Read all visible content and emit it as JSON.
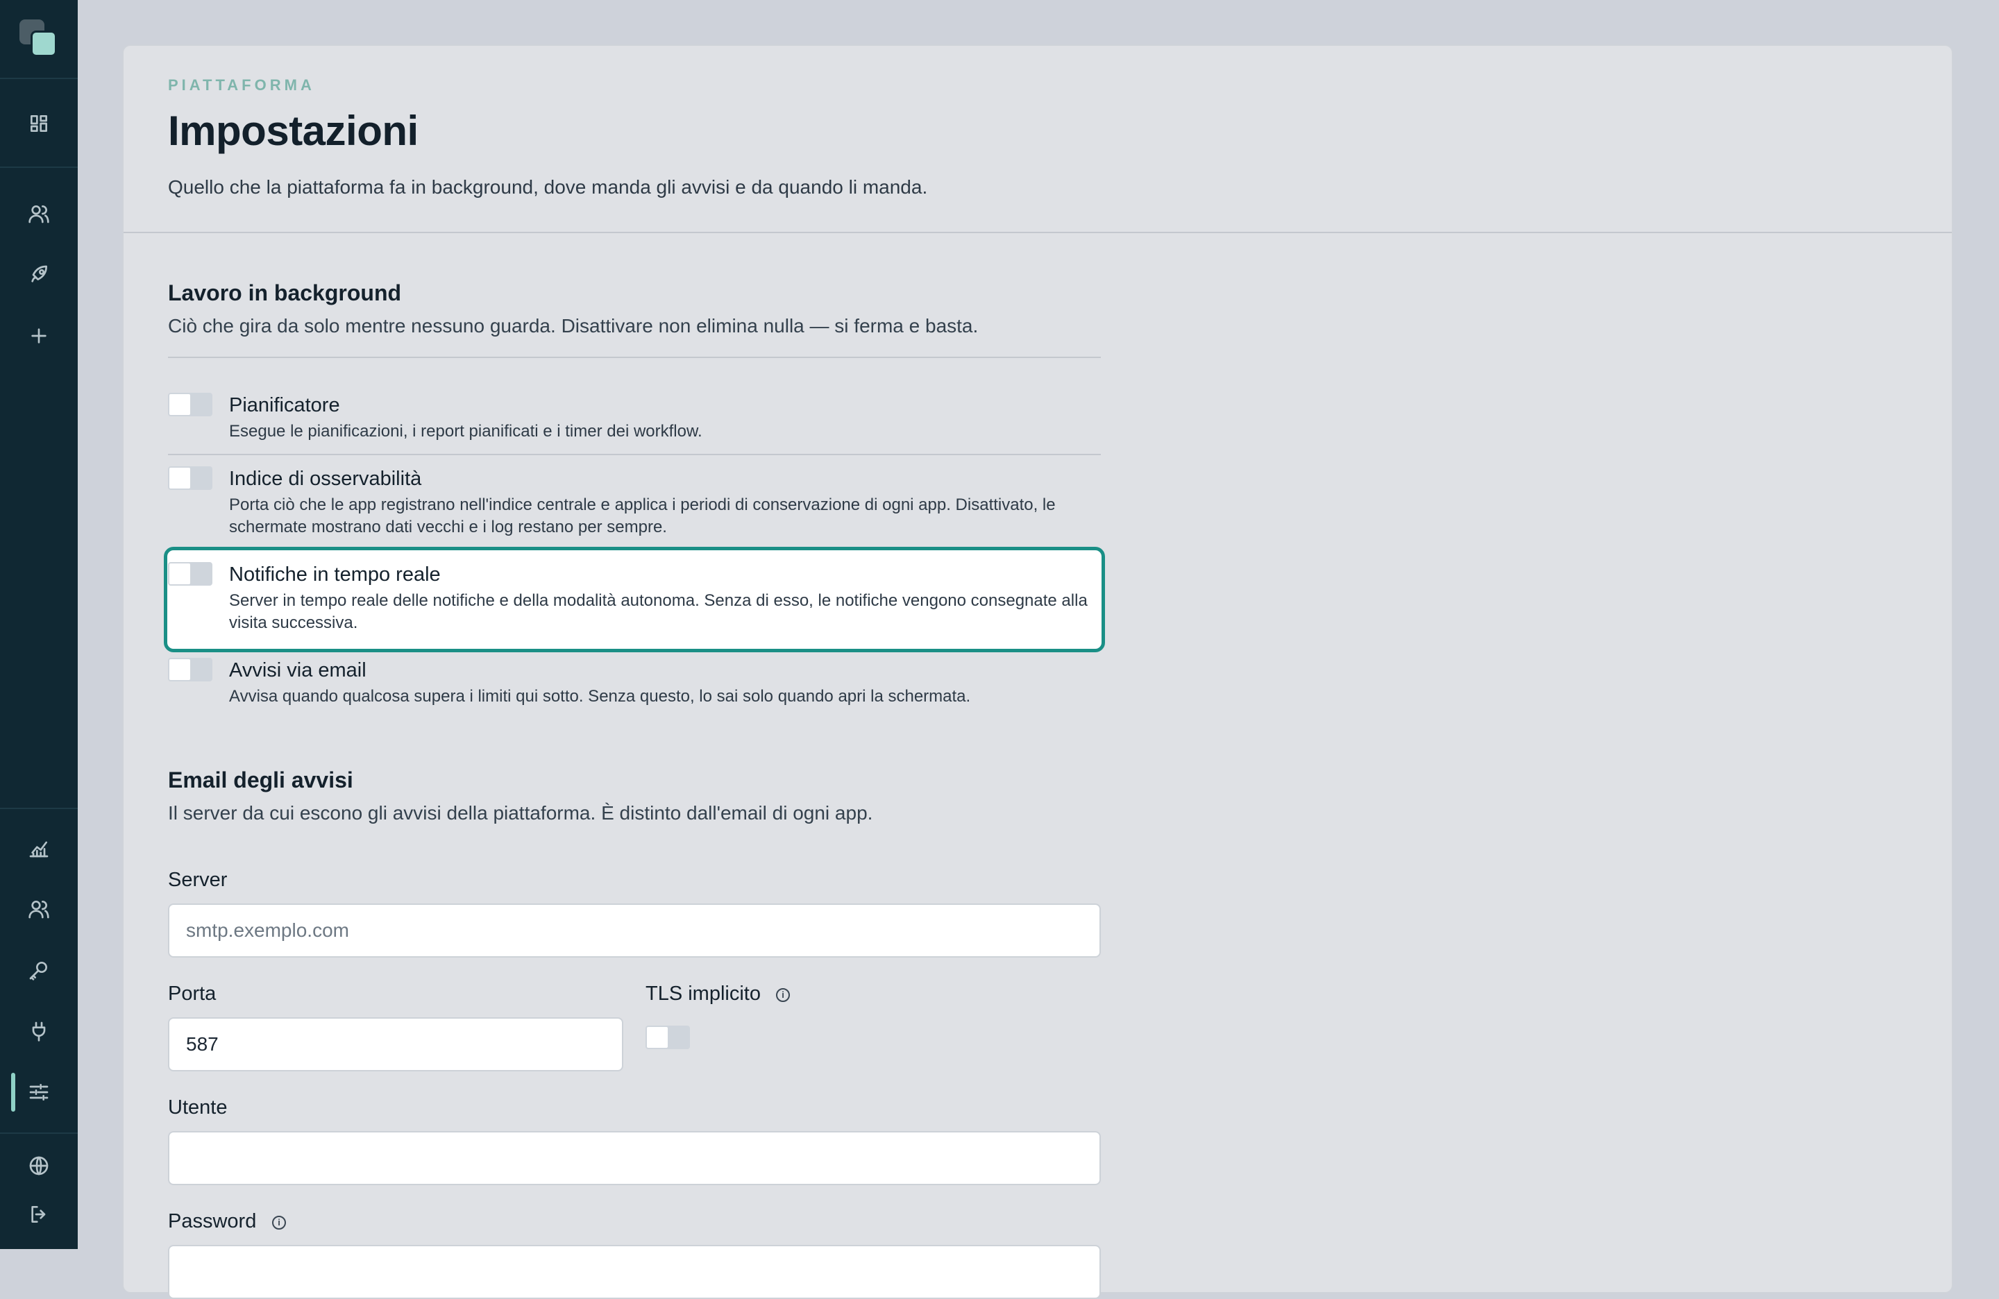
{
  "header": {
    "eyebrow": "PIATTAFORMA",
    "title": "Impostazioni",
    "subtitle": "Quello che la piattaforma fa in background, dove manda gli avvisi e da quando li manda."
  },
  "background_section": {
    "title": "Lavoro in background",
    "subtitle": "Ciò che gira da solo mentre nessuno guarda. Disattivare non elimina nulla — si ferma e basta.",
    "items": [
      {
        "title": "Pianificatore",
        "desc": "Esegue le pianificazioni, i report pianificati e i timer dei workflow.",
        "enabled": false
      },
      {
        "title": "Indice di osservabilità",
        "desc": "Porta ciò che le app registrano nell'indice centrale e applica i periodi di conservazione di ogni app. Disattivato, le schermate mostrano dati vecchi e i log restano per sempre.",
        "enabled": false
      },
      {
        "title": "Notifiche in tempo reale",
        "desc": "Server in tempo reale delle notifiche e della modalità autonoma. Senza di esso, le notifiche vengono consegnate alla visita successiva.",
        "enabled": false,
        "focused": true
      },
      {
        "title": "Avvisi via email",
        "desc": "Avvisa quando qualcosa supera i limiti qui sotto. Senza questo, lo sai solo quando apri la schermata.",
        "enabled": false
      }
    ]
  },
  "email_section": {
    "title": "Email degli avvisi",
    "subtitle": "Il server da cui escono gli avvisi della piattaforma. È distinto dall'email di ogni app.",
    "server_label": "Server",
    "server_placeholder": "smtp.exemplo.com",
    "server_value": "",
    "port_label": "Porta",
    "port_value": "587",
    "tls_label": "TLS implicito",
    "tls_enabled": false,
    "user_label": "Utente",
    "user_value": "",
    "password_label": "Password"
  },
  "sidebar": {
    "top_icons": [
      "dashboard-icon",
      "users-icon",
      "rocket-icon",
      "plus-icon"
    ],
    "bottom_icons": [
      "analytics-icon",
      "team-icon",
      "key-icon",
      "plug-icon",
      "settings-sliders-icon",
      "globe-icon",
      "logout-icon"
    ],
    "active": "settings-sliders-icon"
  },
  "colors": {
    "sidebar_bg": "#102833",
    "accent": "#1a8f86",
    "logo_accent": "#9fd8cf"
  }
}
